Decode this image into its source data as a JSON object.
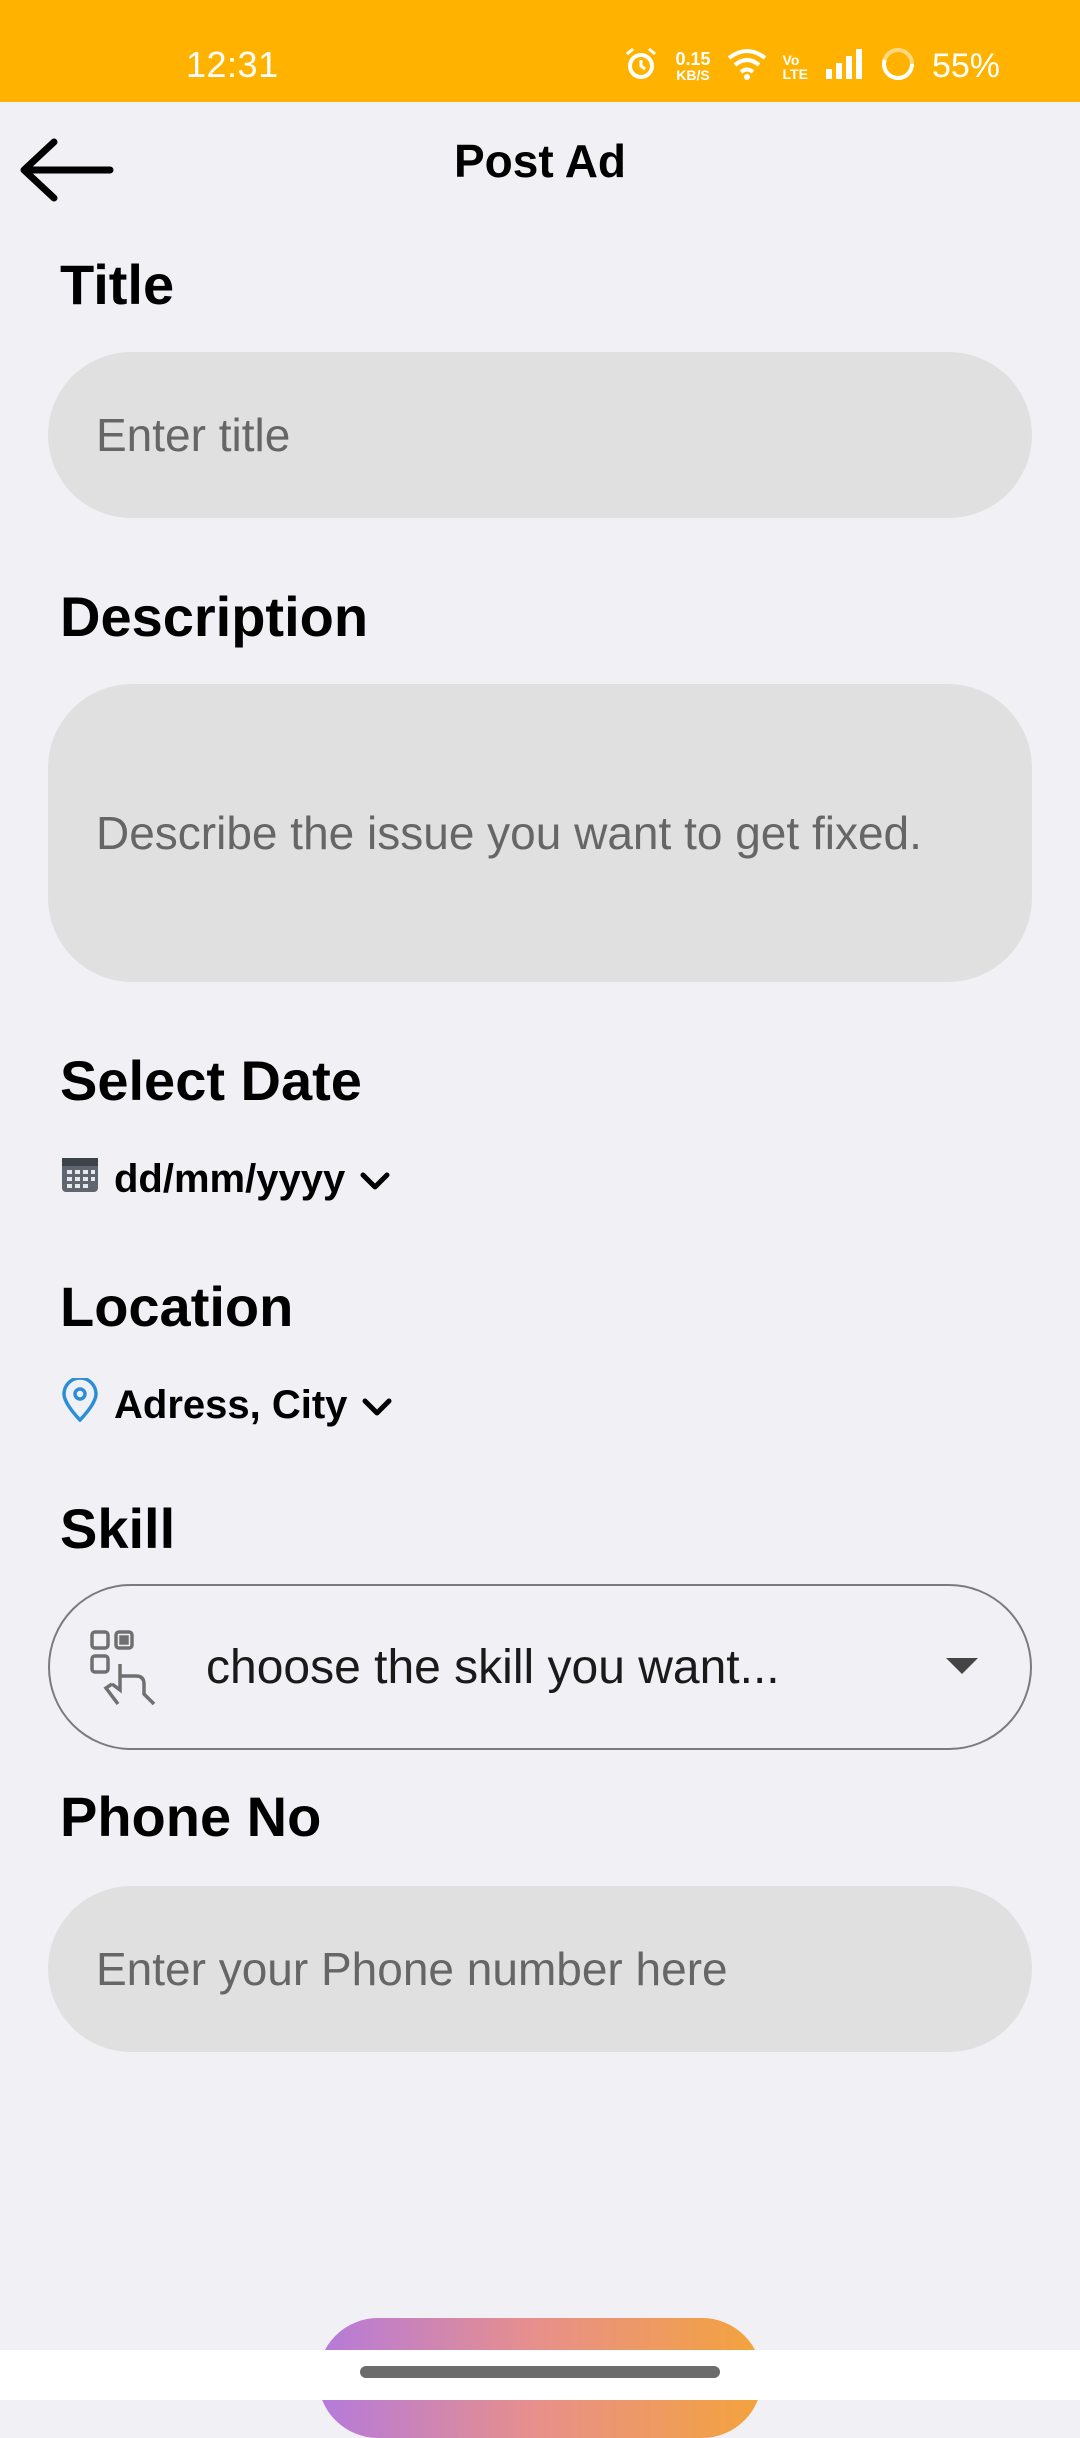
{
  "status_bar": {
    "time": "12:31",
    "net_speed": "0.15",
    "net_speed_unit": "KB/S",
    "volte_top": "Vo",
    "volte_bottom": "LTE",
    "battery": "55%",
    "icons": [
      "alarm-icon",
      "wifi-icon",
      "signal-icon",
      "battery-icon"
    ]
  },
  "header": {
    "title": "Post Ad",
    "back_icon": "arrow-left-icon"
  },
  "form": {
    "title_label": "Title",
    "title_placeholder": "Enter title",
    "description_label": "Description",
    "description_placeholder": "Describe the issue you want to get fixed.",
    "date_label": "Select Date",
    "date_value": "dd/mm/yyyy",
    "location_label": "Location",
    "location_value": "Adress, City",
    "skill_label": "Skill",
    "skill_placeholder": "choose the skill you want...",
    "phone_label": "Phone No",
    "phone_placeholder": "Enter your Phone number here"
  },
  "colors": {
    "status_bar": "#ffb300",
    "background": "#f1f1f5",
    "field_bg": "#e0e0e0",
    "location_pin": "#2a8fd6"
  }
}
